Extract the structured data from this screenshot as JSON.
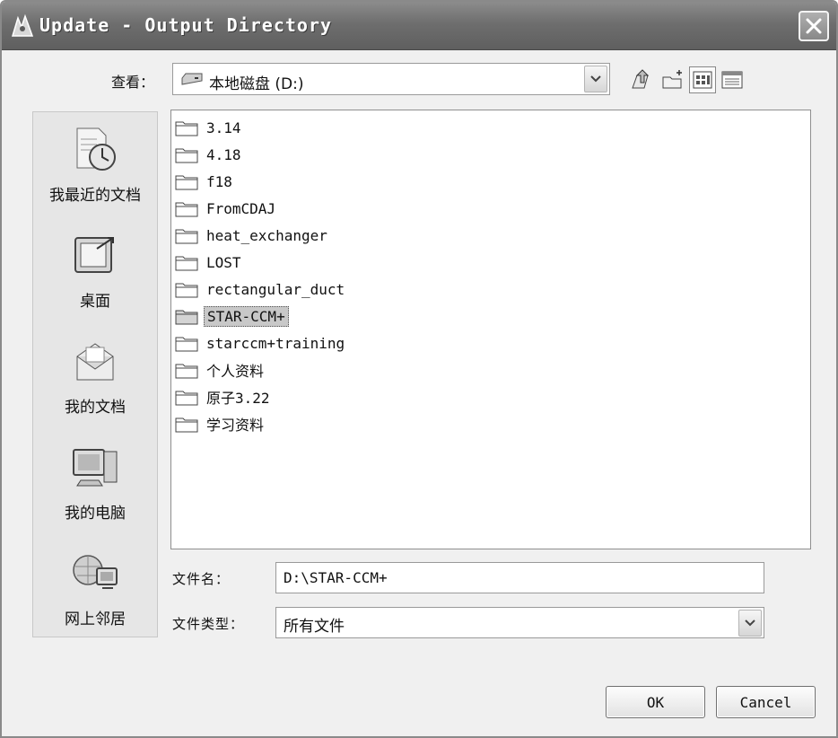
{
  "window": {
    "title": "Update - Output Directory"
  },
  "lookin": {
    "label": "查看：",
    "value": "本地磁盘 (D:)"
  },
  "places": [
    {
      "label": "我最近的文档",
      "icon": "recent-documents-icon"
    },
    {
      "label": "桌面",
      "icon": "desktop-icon"
    },
    {
      "label": "我的文档",
      "icon": "my-documents-icon"
    },
    {
      "label": "我的电脑",
      "icon": "my-computer-icon"
    },
    {
      "label": "网上邻居",
      "icon": "network-places-icon"
    }
  ],
  "files": [
    {
      "name": "3.14"
    },
    {
      "name": "4.18"
    },
    {
      "name": "f18"
    },
    {
      "name": "FromCDAJ"
    },
    {
      "name": "heat_exchanger"
    },
    {
      "name": "LOST"
    },
    {
      "name": "rectangular_duct"
    },
    {
      "name": "STAR-CCM+",
      "selected": true
    },
    {
      "name": "starccm+training"
    },
    {
      "name": "个人资料"
    },
    {
      "name": "原子3.22"
    },
    {
      "name": "学习资料"
    }
  ],
  "filename": {
    "label": "文件名：",
    "value": "D:\\STAR-CCM+"
  },
  "filetype": {
    "label": "文件类型：",
    "value": "所有文件"
  },
  "buttons": {
    "ok": "OK",
    "cancel": "Cancel"
  }
}
